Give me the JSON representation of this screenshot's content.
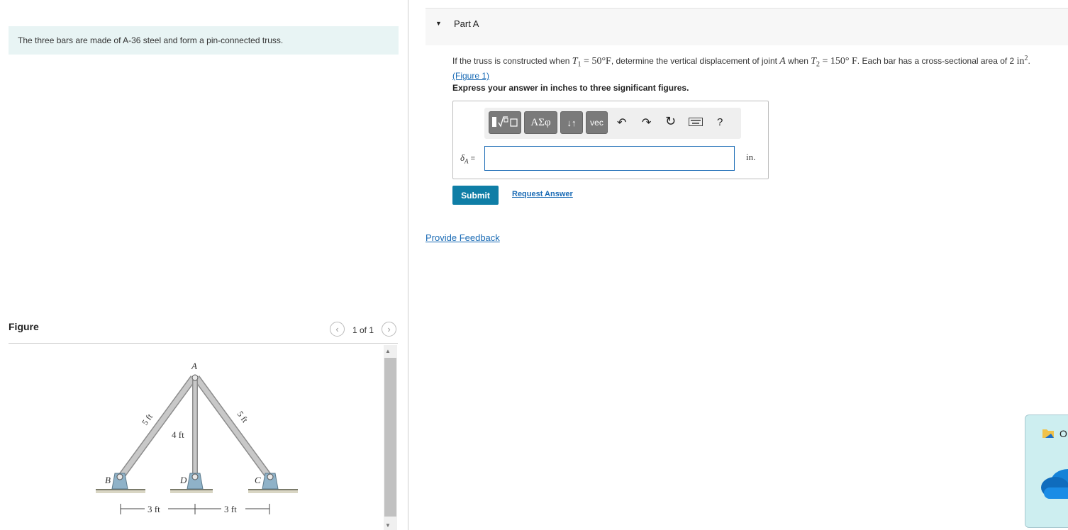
{
  "left": {
    "intro": "The three bars are made of A-36 steel and form a pin-connected truss.",
    "figure_heading": "Figure",
    "page_counter": "1 of 1",
    "prev_icon": "chevron-left-icon",
    "next_icon": "chevron-right-icon",
    "diagram": {
      "labels": {
        "A": "A",
        "B": "B",
        "C": "C",
        "D": "D"
      },
      "dims": {
        "left_bar": "5 ft",
        "right_bar": "5 ft",
        "middle_bar": "4 ft",
        "left_span": "3 ft",
        "right_span": "3 ft"
      }
    }
  },
  "part": {
    "title": "Part A",
    "q_pre": "If the truss is constructed when ",
    "T1_sym": "T",
    "T1_sub": "1",
    "T1_val": " = 50°F",
    "q_mid": ", determine the vertical displacement of joint ",
    "joint": "A",
    "q_when": " when ",
    "T2_sym": "T",
    "T2_sub": "2",
    "T2_val": " = 150° F",
    "q_post": ". Each bar has a cross-sectional area of 2 ",
    "area_unit": "in",
    "area_exp": "2",
    "q_end": ".",
    "figure_link": "(Figure 1)",
    "instruction": "Express your answer in inches to three significant figures."
  },
  "toolbar": {
    "greek": "ΑΣφ",
    "arrows": "↓↑",
    "vec": "vec",
    "help": "?"
  },
  "answer": {
    "label": "δ",
    "label_sub": "A",
    "equals": " =",
    "unit": "in.",
    "value": ""
  },
  "actions": {
    "submit": "Submit",
    "request": "Request Answer",
    "feedback": "Provide Feedback"
  },
  "notification": {
    "text": "O"
  }
}
